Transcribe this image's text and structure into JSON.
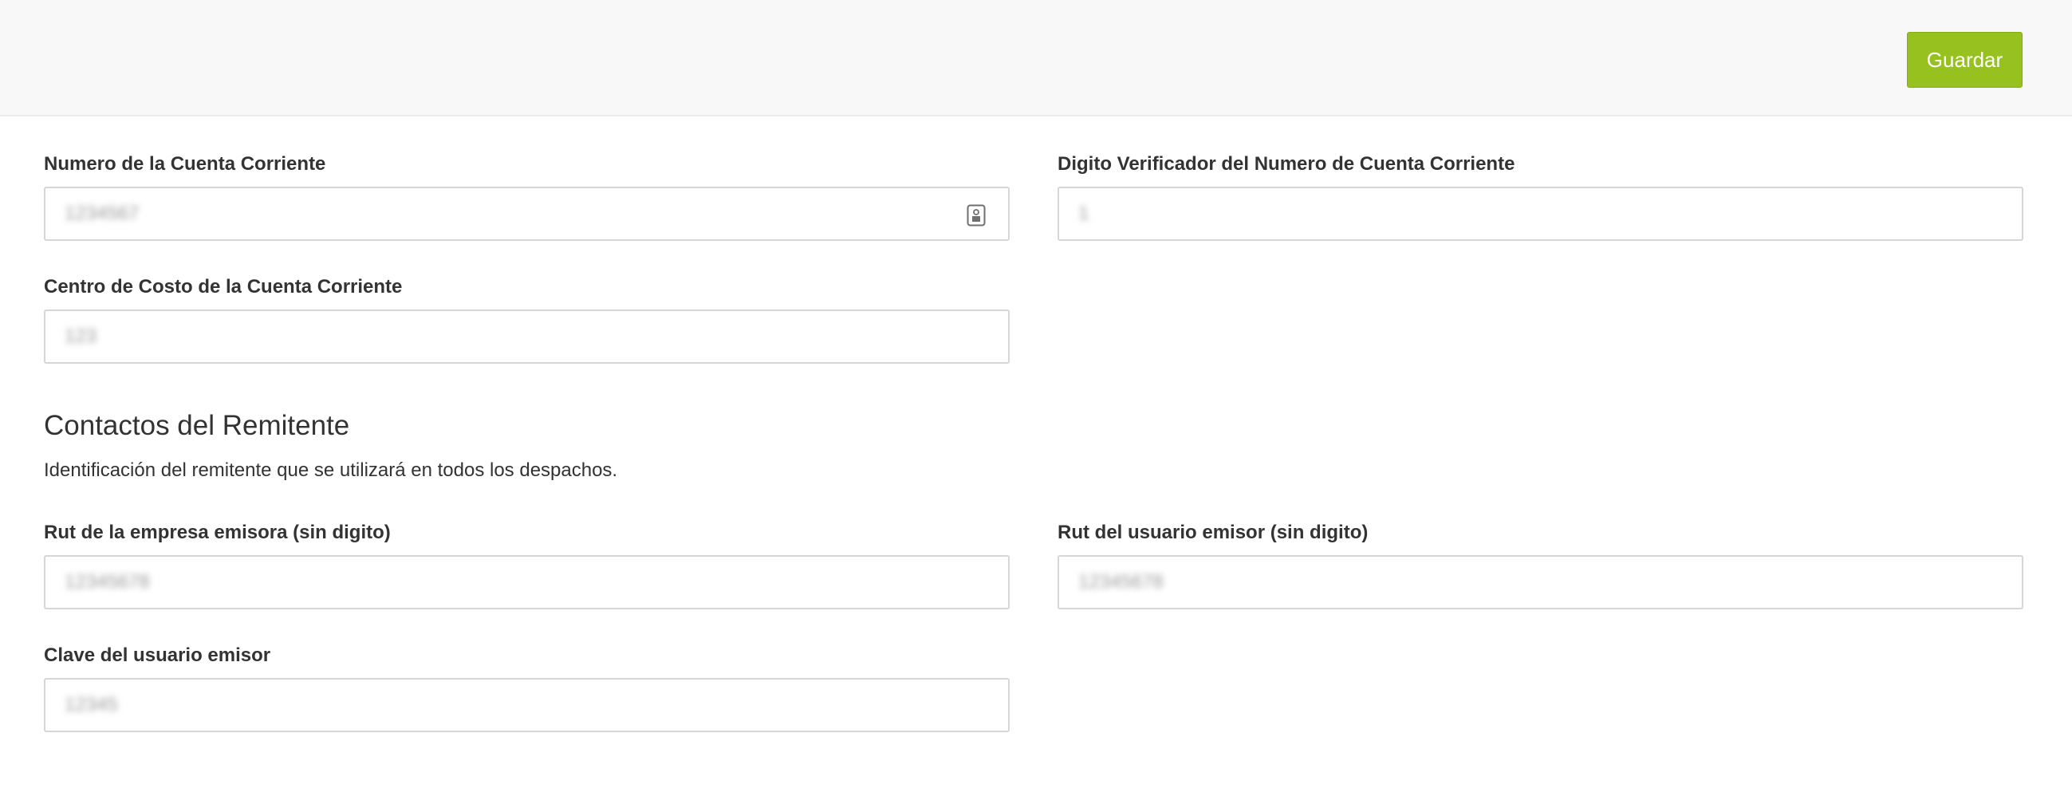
{
  "toolbar": {
    "save_label": "Guardar",
    "save_color": "#96c11f"
  },
  "account": {
    "numero": {
      "label": "Numero de la Cuenta Corriente",
      "value": "1234567"
    },
    "digito": {
      "label": "Digito Verificador del Numero de Cuenta Corriente",
      "value": "1"
    },
    "centro_costo": {
      "label": "Centro de Costo de la Cuenta Corriente",
      "value": "123"
    }
  },
  "contacts": {
    "title": "Contactos del Remitente",
    "description": "Identificación del remitente que se utilizará en todos los despachos.",
    "rut_empresa": {
      "label": "Rut de la empresa emisora (sin digito)",
      "value": "12345678"
    },
    "rut_usuario": {
      "label": "Rut del usuario emisor (sin digito)",
      "value": "12345678"
    },
    "clave": {
      "label": "Clave del usuario emisor",
      "value": "12345"
    }
  }
}
